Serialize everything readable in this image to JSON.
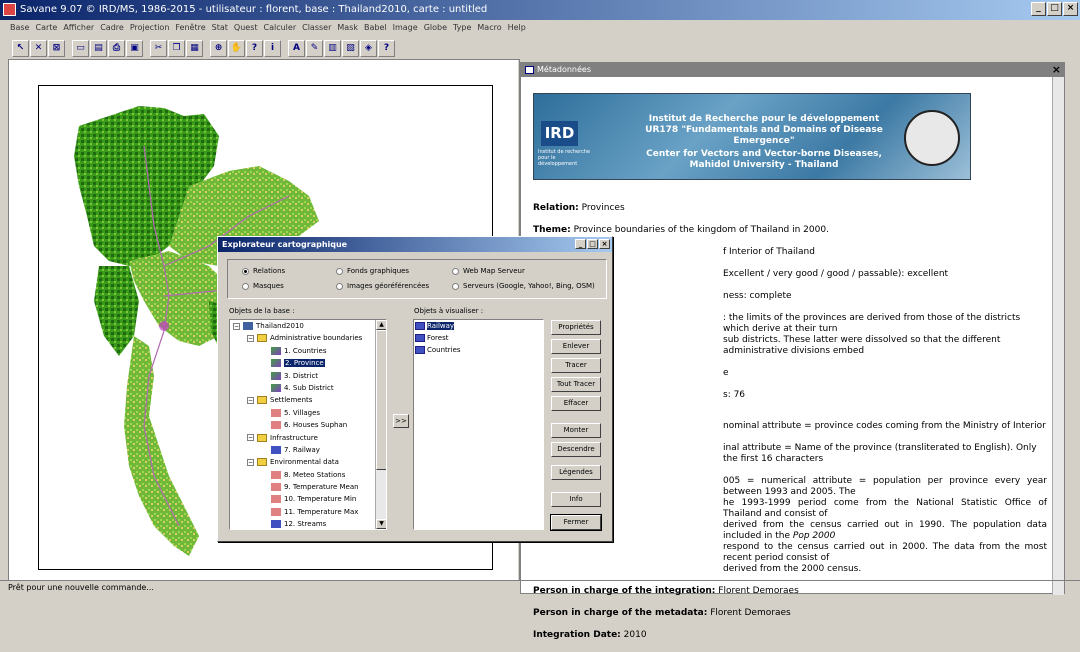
{
  "app": {
    "title": "Savane 9.07 © IRD/MS, 1986-2015  -  utilisateur : florent,  base : Thailand2010,  carte : untitled",
    "status": "Prêt pour une nouvelle commande..."
  },
  "menu": [
    "Base",
    "Carte",
    "Afficher",
    "Cadre",
    "Projection",
    "Fenêtre",
    "Stat",
    "Quest",
    "Calculer",
    "Classer",
    "Mask",
    "Babel",
    "Image",
    "Globe",
    "Type",
    "Macro",
    "Help"
  ],
  "toolbar": {
    "icons": [
      "arrow-icon",
      "cross-icon",
      "delete-icon",
      "open-icon",
      "save-icon",
      "print-icon",
      "window-icon",
      "cut-icon",
      "copy-icon",
      "paste-icon",
      "zoom-icon",
      "pan-icon",
      "query-icon",
      "info-icon",
      "text-icon",
      "pencil-icon",
      "chart-icon",
      "legend-icon",
      "palette-icon",
      "help-icon"
    ]
  },
  "metadata_window": {
    "title": "Métadonnées",
    "banner": {
      "logo": "IRD",
      "logo_sub": "Institut de recherche pour le développement",
      "line1": "Institut de Recherche pour le développement",
      "line2": "UR178 \"Fundamentals and Domains of Disease Emergence\"",
      "line3": "Center for Vectors and Vector-borne Diseases,",
      "line4": "Mahidol University - Thailand"
    },
    "relation_label": "Relation:",
    "relation": "Provinces",
    "theme_label": "Theme:",
    "theme": "Province boundaries of the kingdom of Thailand in 2000.",
    "source_partial": "f Interior of Thailand",
    "quality_partial": "Excellent / very good / good / passable): excellent",
    "completeness_partial": "ness: complete",
    "method_partial": ": the limits of the provinces are derived from those of the districts which derive at their turn",
    "method_partial2": "sub districts. These latter were dissolved so that the different administrative divisions embed",
    "e_partial": "e",
    "objects_partial": "s: 76",
    "attr1_partial": "nominal attribute = province codes coming from the Ministry of Interior",
    "attr2_partial": "inal attribute = Name of the province (transliterated to English). Only the first 16 characters",
    "attr3_l1": "005 = numerical attribute = population per province every year between 1993 and 2005. The",
    "attr3_l2": "he 1993-1999 period come from the National Statistic Office of Thailand and consist of",
    "attr3_l3": "derived from the census carried out in 1990. The population data included in the",
    "attr3_l3_it": "Pop 2000",
    "attr3_l4": "respond to the census carried out in 2000. The data from the most recent period consist of",
    "attr3_l5": "derived from the 2000 census.",
    "integration_label": "Person in charge of the integration:",
    "integration": "Florent Demoraes",
    "metadata_label": "Person in charge of the metadata:",
    "metadata": "Florent Demoraes",
    "date_label": "Integration Date:",
    "date": "2010"
  },
  "explorer": {
    "title": "Explorateur cartographique",
    "radios": {
      "relations": "Relations",
      "masques": "Masques",
      "fonds": "Fonds graphiques",
      "images": "Images géoréférencées",
      "wms": "Web Map Serveur",
      "serveurs": "Serveurs (Google, Yahoo!, Bing, OSM)"
    },
    "base_label": "Objets de la base :",
    "visual_label": "Objets à visualiser :",
    "tree": [
      {
        "label": "Thailand2010",
        "level": 0,
        "type": "root"
      },
      {
        "label": "Administrative boundaries",
        "level": 1,
        "type": "folder"
      },
      {
        "label": "1. Countries",
        "level": 2,
        "type": "poly"
      },
      {
        "label": "2. Province",
        "level": 2,
        "type": "poly",
        "selected": true
      },
      {
        "label": "3. District",
        "level": 2,
        "type": "poly"
      },
      {
        "label": "4. Sub District",
        "level": 2,
        "type": "poly"
      },
      {
        "label": "Settlements",
        "level": 1,
        "type": "folder"
      },
      {
        "label": "5. Villages",
        "level": 2,
        "type": "point"
      },
      {
        "label": "6. Houses Suphan",
        "level": 2,
        "type": "point"
      },
      {
        "label": "Infrastructure",
        "level": 1,
        "type": "folder"
      },
      {
        "label": "7. Railway",
        "level": 2,
        "type": "line"
      },
      {
        "label": "Environmental data",
        "level": 1,
        "type": "folder"
      },
      {
        "label": "8. Meteo Stations",
        "level": 2,
        "type": "point"
      },
      {
        "label": "9. Temperature Mean",
        "level": 2,
        "type": "point"
      },
      {
        "label": "10. Temperature Min",
        "level": 2,
        "type": "point"
      },
      {
        "label": "11. Temperature Max",
        "level": 2,
        "type": "point"
      },
      {
        "label": "12. Streams",
        "level": 2,
        "type": "line"
      }
    ],
    "add_button": ">>",
    "visual_items": [
      "Railway",
      "Forest",
      "Countries"
    ],
    "buttons": {
      "props": "Propriétés",
      "remove": "Enlever",
      "draw": "Tracer",
      "drawall": "Tout Tracer",
      "erase": "Effacer",
      "up": "Monter",
      "down": "Descendre",
      "legend": "Légendes",
      "info": "Info",
      "close": "Fermer"
    }
  }
}
